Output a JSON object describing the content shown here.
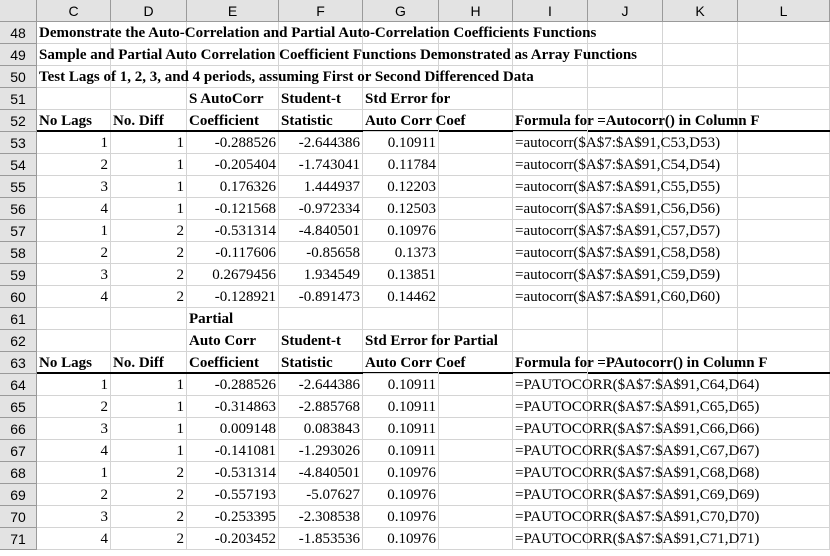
{
  "columns": [
    "C",
    "D",
    "E",
    "F",
    "G",
    "H",
    "I",
    "J",
    "K",
    "L"
  ],
  "rows": [
    {
      "n": "48",
      "title": "Demonstrate the Auto-Correlation and Partial Auto-Correlation Coefficients Functions"
    },
    {
      "n": "49",
      "title": "Sample and Partial Auto Correlation Coefficient Functions Demonstrated as Array Functions"
    },
    {
      "n": "50",
      "title": "Test Lags of 1, 2, 3, and 4 periods, assuming First or Second Differenced Data"
    },
    {
      "n": "51",
      "E": "S AutoCorr",
      "F": "Student-t",
      "G": "Std Error for"
    },
    {
      "n": "52",
      "C": "No Lags",
      "D": "No. Diff",
      "E": "Coefficient",
      "F": "Statistic",
      "G": "Auto Corr Coef",
      "I": "Formula for =Autocorr() in Column F"
    },
    {
      "n": "53",
      "C": "1",
      "D": "1",
      "E": "-0.288526",
      "F": "-2.644386",
      "G": "0.10911",
      "I": "=autocorr($A$7:$A$91,C53,D53)"
    },
    {
      "n": "54",
      "C": "2",
      "D": "1",
      "E": "-0.205404",
      "F": "-1.743041",
      "G": "0.11784",
      "I": "=autocorr($A$7:$A$91,C54,D54)"
    },
    {
      "n": "55",
      "C": "3",
      "D": "1",
      "E": "0.176326",
      "F": "1.444937",
      "G": "0.12203",
      "I": "=autocorr($A$7:$A$91,C55,D55)"
    },
    {
      "n": "56",
      "C": "4",
      "D": "1",
      "E": "-0.121568",
      "F": "-0.972334",
      "G": "0.12503",
      "I": "=autocorr($A$7:$A$91,C56,D56)"
    },
    {
      "n": "57",
      "C": "1",
      "D": "2",
      "E": "-0.531314",
      "F": "-4.840501",
      "G": "0.10976",
      "I": "=autocorr($A$7:$A$91,C57,D57)"
    },
    {
      "n": "58",
      "C": "2",
      "D": "2",
      "E": "-0.117606",
      "F": "-0.85658",
      "G": "0.1373",
      "I": "=autocorr($A$7:$A$91,C58,D58)"
    },
    {
      "n": "59",
      "C": "3",
      "D": "2",
      "E": "0.2679456",
      "F": "1.934549",
      "G": "0.13851",
      "I": "=autocorr($A$7:$A$91,C59,D59)"
    },
    {
      "n": "60",
      "C": "4",
      "D": "2",
      "E": "-0.128921",
      "F": "-0.891473",
      "G": "0.14462",
      "I": "=autocorr($A$7:$A$91,C60,D60)"
    },
    {
      "n": "61",
      "E": "Partial"
    },
    {
      "n": "62",
      "E": "Auto Corr",
      "F": "Student-t",
      "G": "Std Error for Partial"
    },
    {
      "n": "63",
      "C": "No Lags",
      "D": "No. Diff",
      "E": "Coefficient",
      "F": "Statistic",
      "G": "Auto Corr Coef",
      "I": "Formula for =PAutocorr() in Column F"
    },
    {
      "n": "64",
      "C": "1",
      "D": "1",
      "E": "-0.288526",
      "F": "-2.644386",
      "G": "0.10911",
      "I": "=PAUTOCORR($A$7:$A$91,C64,D64)"
    },
    {
      "n": "65",
      "C": "2",
      "D": "1",
      "E": "-0.314863",
      "F": "-2.885768",
      "G": "0.10911",
      "I": "=PAUTOCORR($A$7:$A$91,C65,D65)"
    },
    {
      "n": "66",
      "C": "3",
      "D": "1",
      "E": "0.009148",
      "F": "0.083843",
      "G": "0.10911",
      "I": "=PAUTOCORR($A$7:$A$91,C66,D66)"
    },
    {
      "n": "67",
      "C": "4",
      "D": "1",
      "E": "-0.141081",
      "F": "-1.293026",
      "G": "0.10911",
      "I": "=PAUTOCORR($A$7:$A$91,C67,D67)"
    },
    {
      "n": "68",
      "C": "1",
      "D": "2",
      "E": "-0.531314",
      "F": "-4.840501",
      "G": "0.10976",
      "I": "=PAUTOCORR($A$7:$A$91,C68,D68)"
    },
    {
      "n": "69",
      "C": "2",
      "D": "2",
      "E": "-0.557193",
      "F": "-5.07627",
      "G": "0.10976",
      "I": "=PAUTOCORR($A$7:$A$91,C69,D69)"
    },
    {
      "n": "70",
      "C": "3",
      "D": "2",
      "E": "-0.253395",
      "F": "-2.308538",
      "G": "0.10976",
      "I": "=PAUTOCORR($A$7:$A$91,C70,D70)"
    },
    {
      "n": "71",
      "C": "4",
      "D": "2",
      "E": "-0.203452",
      "F": "-1.853536",
      "G": "0.10976",
      "I": "=PAUTOCORR($A$7:$A$91,C71,D71)"
    }
  ]
}
